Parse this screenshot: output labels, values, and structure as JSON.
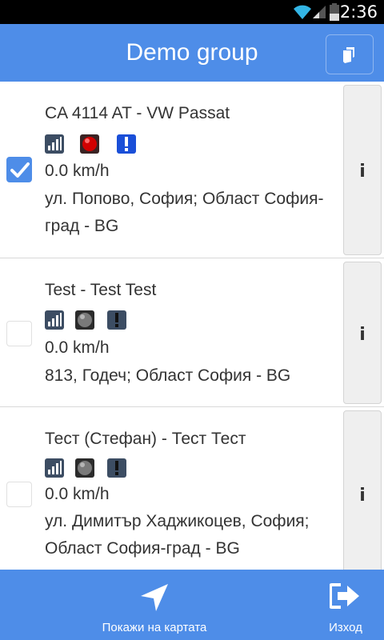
{
  "status_bar": {
    "time": "2:36"
  },
  "header": {
    "title": "Demo group",
    "copy_icon": "copy-icon"
  },
  "vehicles": [
    {
      "name": "CA 4114 AT - VW Passat",
      "selected": true,
      "status_icons": [
        "signal-icon",
        "red-status-icon",
        "alert-blue-icon"
      ],
      "speed": "0.0 km/h",
      "address": "ул. Попово, София; Област София-град - BG"
    },
    {
      "name": "Test - Test Test",
      "selected": false,
      "status_icons": [
        "signal-icon",
        "gray-status-icon",
        "alert-dark-icon"
      ],
      "speed": "0.0 km/h",
      "address": "813, Годеч; Област София - BG"
    },
    {
      "name": "Тест (Стефан) - Тест Тест",
      "selected": false,
      "status_icons": [
        "signal-icon",
        "gray-status-icon",
        "alert-dark-icon"
      ],
      "speed": "0.0 km/h",
      "address": "ул. Димитър Хаджикоцев, София; Област София-град - BG"
    }
  ],
  "info_button_label": "i",
  "footer": {
    "show_on_map_label": "Покажи на картата",
    "exit_label": "Изход"
  },
  "colors": {
    "accent": "#4e8de8",
    "red_status": "#d10000",
    "alert_blue": "#1a4fd8"
  }
}
